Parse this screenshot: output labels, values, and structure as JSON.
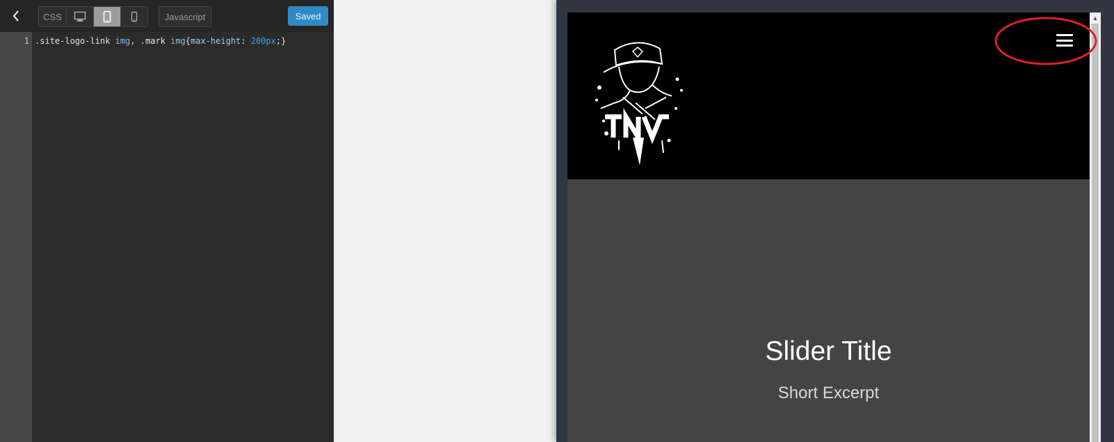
{
  "toolbar": {
    "back_icon": "chevron-left-icon",
    "css_tab_label": "CSS",
    "desktop_icon": "monitor-icon",
    "tablet_icon": "tablet-icon",
    "mobile_icon": "phone-icon",
    "active_device": "tablet",
    "javascript_label": "Javascript",
    "saved_label": "Saved",
    "saved_color": "#2f8ac4"
  },
  "editor": {
    "lines": [
      {
        "number": "1",
        "selector_a": ".site-logo-link ",
        "tag_a": "img",
        "sep": ", ",
        "selector_b": ".mark ",
        "tag_b": "img",
        "open": "{",
        "property": "max-height",
        "colon": ": ",
        "value": "200px",
        "close": ";}"
      }
    ],
    "background": "#2b2b2b"
  },
  "preview": {
    "header_background": "#000000",
    "logo_icon": "band-logo-image",
    "menu_icon": "hamburger-menu-icon",
    "slider_title": "Slider Title",
    "slider_excerpt": "Short Excerpt",
    "slider_background": "#444444"
  },
  "annotation": {
    "shape": "ellipse",
    "color": "#e0202a",
    "target": "hamburger-menu-icon"
  }
}
